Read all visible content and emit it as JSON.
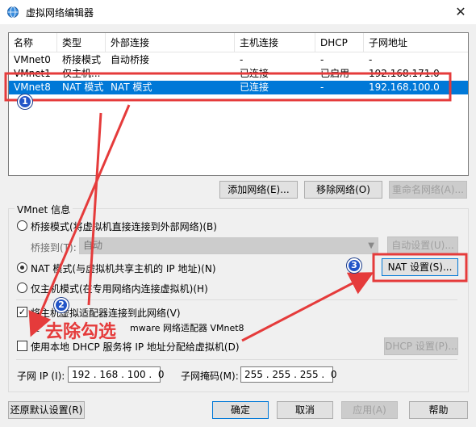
{
  "window": {
    "title": "虚拟网络编辑器",
    "close_icon": "close-icon"
  },
  "table": {
    "headers": [
      "名称",
      "类型",
      "外部连接",
      "主机连接",
      "DHCP",
      "子网地址"
    ],
    "rows": [
      [
        "VMnet0",
        "桥接模式",
        "自动桥接",
        "-",
        "-",
        "-"
      ],
      [
        "VMnet1",
        "仅主机...",
        "-",
        "已连接",
        "已启用",
        "192.168.171.0"
      ],
      [
        "VMnet8",
        "NAT 模式",
        "NAT 模式",
        "已连接",
        "-",
        "192.168.100.0"
      ]
    ],
    "selected_row": 2
  },
  "list_buttons": {
    "add": "添加网络(E)...",
    "remove": "移除网络(O)",
    "rename": "重命名网络(A)..."
  },
  "vmnet_info": {
    "group_title": "VMnet 信息",
    "bridge_radio": "桥接模式(将虚拟机直接连接到外部网络)(B)",
    "bridge_to_label": "桥接到(T):",
    "bridge_to_value": "自动",
    "auto_settings_button": "自动设置(U)...",
    "nat_radio": "NAT 模式(与虚拟机共享主机的 IP 地址)(N)",
    "nat_settings_button": "NAT 设置(S)...",
    "hostonly_radio": "仅主机模式(在专用网络内连接虚拟机)(H)",
    "connect_adapter_check": "将主机虚拟适配器连接到此网络(V)",
    "adapter_name_prefix": "主",
    "adapter_name": "mware 网络适配器 VMnet8",
    "dhcp_check": "使用本地 DHCP 服务将 IP 地址分配给虚拟机(D)",
    "dhcp_settings_button": "DHCP 设置(P)...",
    "subnet_ip_label": "子网 IP (I):",
    "subnet_ip_value": "192 . 168 . 100 .  0",
    "subnet_mask_label": "子网掩码(M):",
    "subnet_mask_value": "255 . 255 . 255 .  0"
  },
  "bottom_buttons": {
    "restore": "还原默认设置(R)",
    "ok": "确定",
    "cancel": "取消",
    "apply": "应用(A)",
    "help": "帮助"
  },
  "annotations": {
    "badge1": "1",
    "badge2": "2",
    "badge3": "3",
    "remove_check_text": "去除勾选",
    "color": "#e53b3b"
  }
}
